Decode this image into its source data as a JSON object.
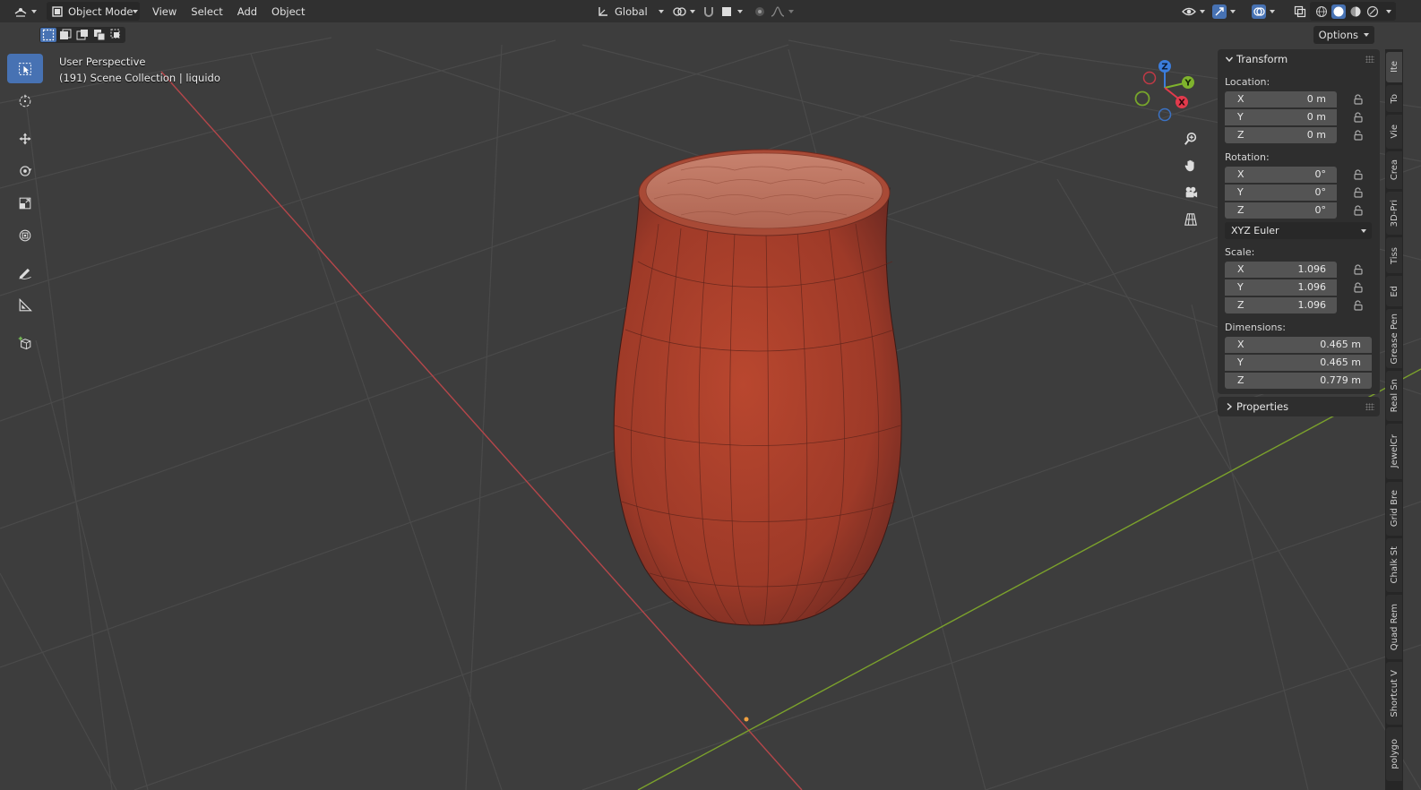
{
  "header": {
    "editor_type_icon": "editor-type-icon",
    "mode": "Object Mode",
    "menus": [
      "View",
      "Select",
      "Add",
      "Object"
    ],
    "orientation": "Global"
  },
  "options_label": "Options",
  "viewport": {
    "perspective": "User Perspective",
    "collection": "(191) Scene Collection | liquido",
    "object_color": "#b8432e",
    "x_axis_color": "#b5464a",
    "y_axis_color": "#7ba12c"
  },
  "gizmo": {
    "z": "Z",
    "y": "Y",
    "x": "X"
  },
  "panel": {
    "transform_title": "Transform",
    "location_label": "Location:",
    "location": [
      {
        "axis": "X",
        "value": "0 m"
      },
      {
        "axis": "Y",
        "value": "0 m"
      },
      {
        "axis": "Z",
        "value": "0 m"
      }
    ],
    "rotation_label": "Rotation:",
    "rotation": [
      {
        "axis": "X",
        "value": "0°"
      },
      {
        "axis": "Y",
        "value": "0°"
      },
      {
        "axis": "Z",
        "value": "0°"
      }
    ],
    "rotation_mode": "XYZ Euler",
    "scale_label": "Scale:",
    "scale": [
      {
        "axis": "X",
        "value": "1.096"
      },
      {
        "axis": "Y",
        "value": "1.096"
      },
      {
        "axis": "Z",
        "value": "1.096"
      }
    ],
    "dimensions_label": "Dimensions:",
    "dimensions": [
      {
        "axis": "X",
        "value": "0.465 m"
      },
      {
        "axis": "Y",
        "value": "0.465 m"
      },
      {
        "axis": "Z",
        "value": "0.779 m"
      }
    ],
    "properties_title": "Properties"
  },
  "side_tabs": [
    "Ite",
    "To",
    "Vie",
    "Crea",
    "3D-Pri",
    "Tiss",
    "Ed",
    "Grease Pen",
    "Real Sn",
    "JewelCr",
    "Grid Bre",
    "Chalk St",
    "Quad Rem",
    "Shortcut V",
    "polygo"
  ]
}
